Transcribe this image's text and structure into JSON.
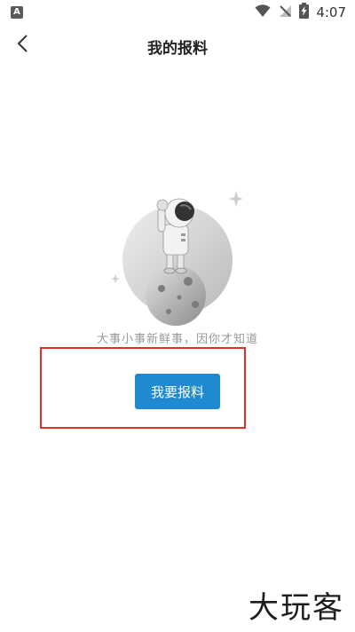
{
  "status_bar": {
    "notification_letter": "A",
    "time": "4:07",
    "icons": [
      "wifi-icon",
      "no-signal-icon",
      "battery-charging-icon"
    ]
  },
  "header": {
    "title": "我的报料",
    "back_icon": "chevron-left-icon"
  },
  "empty_state": {
    "illustration": "astronaut-on-moon-illustration",
    "message": "大事小事新鲜事，因你才知道",
    "button_label": "我要报料"
  },
  "watermark": {
    "text": "大玩客"
  },
  "colors": {
    "accent": "#1f8ad0",
    "highlight": "#e0302a",
    "muted_text": "#9a9a9a"
  }
}
